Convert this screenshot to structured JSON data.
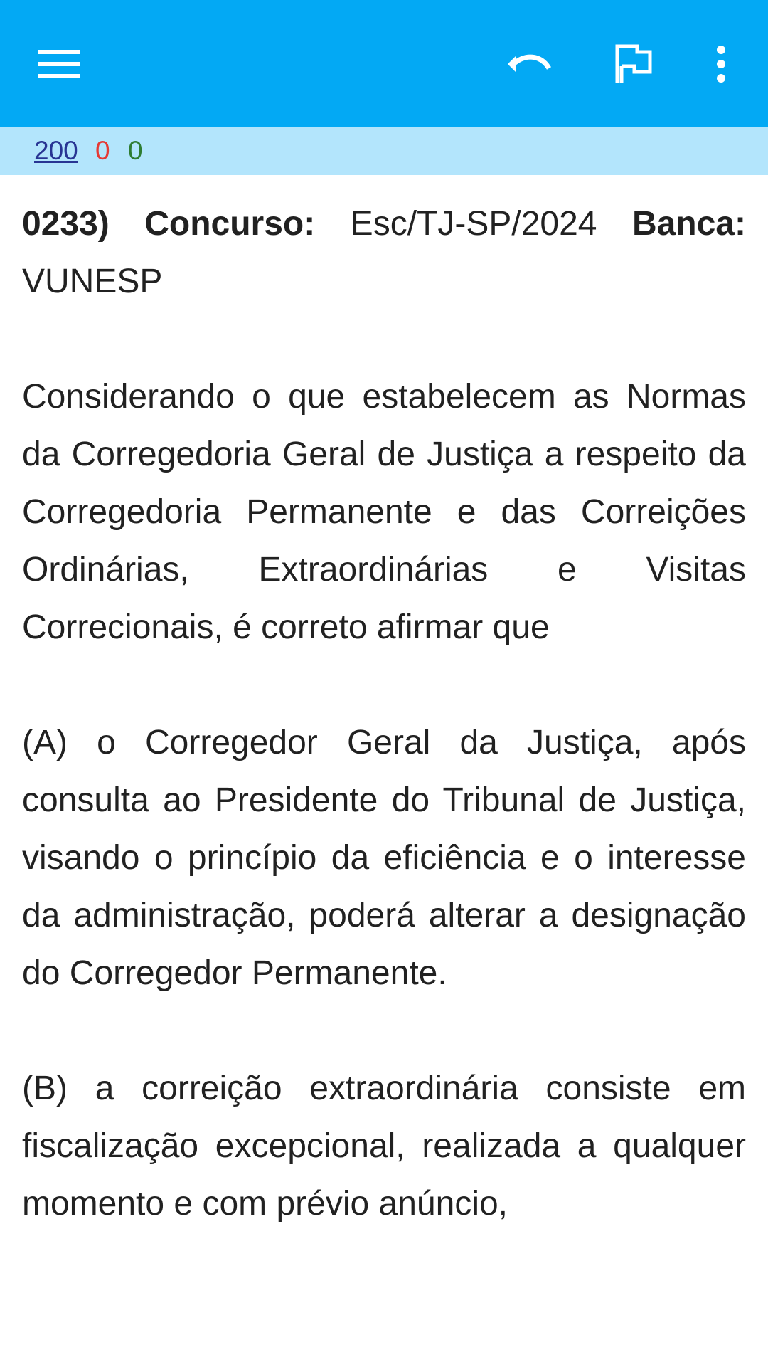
{
  "toolbar": {
    "icons": [
      "menu-icon",
      "undo-icon",
      "flag-icon",
      "more-vert-icon"
    ],
    "color": "#03a9f4"
  },
  "score": {
    "total": "200",
    "wrong": "0",
    "right": "0",
    "bar_color": "#b3e5fc"
  },
  "question": {
    "number": "0233)",
    "concurso_label": "Concurso:",
    "concurso_value": "Esc/TJ-SP/2024",
    "banca_label": "Banca:",
    "banca_value": "VUNESP",
    "statement": "Considerando o que estabelecem as Normas da Corregedoria Geral de Justiça a respeito da Corregedoria Permanente e das Correições Ordinárias, Extraordinárias e Visitas Correcionais, é correto afirmar que",
    "options": [
      {
        "letter": "(A)",
        "text": "o Corregedor Geral da Justiça, após consulta ao Presidente do Tribunal de Justiça, visando o princípio da eficiência e o interesse da administração, poderá alterar a designação do Corregedor Permanente."
      },
      {
        "letter": "(B)",
        "text": "a correição extraordinária consiste em fiscalização excepcional, realizada a qualquer momento e com prévio anúncio,"
      }
    ]
  }
}
